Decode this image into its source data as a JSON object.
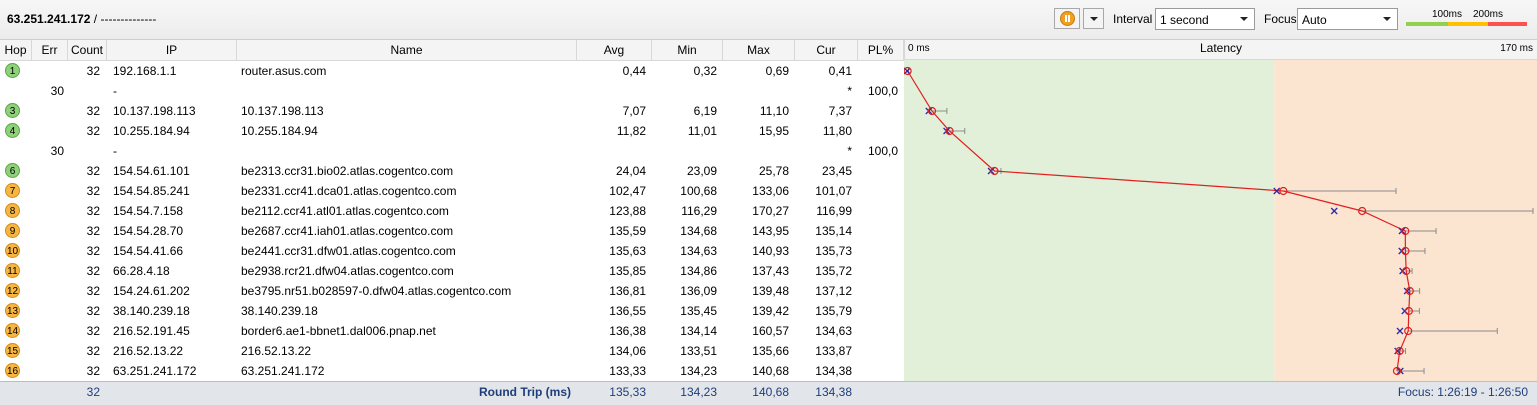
{
  "target": {
    "host": "63.251.241.172",
    "separator": "/",
    "name": "--------------"
  },
  "controls": {
    "interval_label": "Interval",
    "interval_value": "1 second",
    "focus_label": "Focus",
    "focus_value": "Auto",
    "legend": {
      "low": "100ms",
      "high": "200ms"
    }
  },
  "columns": {
    "hop": "Hop",
    "err": "Err",
    "count": "Count",
    "ip": "IP",
    "name": "Name",
    "avg": "Avg",
    "min": "Min",
    "max": "Max",
    "cur": "Cur",
    "pl": "PL%"
  },
  "rows": [
    {
      "hop": "1",
      "status": "green",
      "err": "",
      "count": "32",
      "ip": "192.168.1.1",
      "name": "router.asus.com",
      "avg": "0,44",
      "min": "0,32",
      "max": "0,69",
      "cur": "0,41",
      "pl": ""
    },
    {
      "hop": "",
      "status": "",
      "err": "30",
      "count": "",
      "ip": "-",
      "name": "",
      "avg": "",
      "min": "",
      "max": "",
      "cur": "*",
      "pl": "100,0"
    },
    {
      "hop": "3",
      "status": "green",
      "err": "",
      "count": "32",
      "ip": "10.137.198.113",
      "name": "10.137.198.113",
      "avg": "7,07",
      "min": "6,19",
      "max": "11,10",
      "cur": "7,37",
      "pl": ""
    },
    {
      "hop": "4",
      "status": "green",
      "err": "",
      "count": "32",
      "ip": "10.255.184.94",
      "name": "10.255.184.94",
      "avg": "11,82",
      "min": "11,01",
      "max": "15,95",
      "cur": "11,80",
      "pl": ""
    },
    {
      "hop": "",
      "status": "",
      "err": "30",
      "count": "",
      "ip": "-",
      "name": "",
      "avg": "",
      "min": "",
      "max": "",
      "cur": "*",
      "pl": "100,0"
    },
    {
      "hop": "6",
      "status": "green",
      "err": "",
      "count": "32",
      "ip": "154.54.61.101",
      "name": "be2313.ccr31.bio02.atlas.cogentco.com",
      "avg": "24,04",
      "min": "23,09",
      "max": "25,78",
      "cur": "23,45",
      "pl": ""
    },
    {
      "hop": "7",
      "status": "orange",
      "err": "",
      "count": "32",
      "ip": "154.54.85.241",
      "name": "be2331.ccr41.dca01.atlas.cogentco.com",
      "avg": "102,47",
      "min": "100,68",
      "max": "133,06",
      "cur": "101,07",
      "pl": ""
    },
    {
      "hop": "8",
      "status": "orange",
      "err": "",
      "count": "32",
      "ip": "154.54.7.158",
      "name": "be2112.ccr41.atl01.atlas.cogentco.com",
      "avg": "123,88",
      "min": "116,29",
      "max": "170,27",
      "cur": "116,99",
      "pl": ""
    },
    {
      "hop": "9",
      "status": "orange",
      "err": "",
      "count": "32",
      "ip": "154.54.28.70",
      "name": "be2687.ccr41.iah01.atlas.cogentco.com",
      "avg": "135,59",
      "min": "134,68",
      "max": "143,95",
      "cur": "135,14",
      "pl": ""
    },
    {
      "hop": "10",
      "status": "orange",
      "err": "",
      "count": "32",
      "ip": "154.54.41.66",
      "name": "be2441.ccr31.dfw01.atlas.cogentco.com",
      "avg": "135,63",
      "min": "134,63",
      "max": "140,93",
      "cur": "135,73",
      "pl": ""
    },
    {
      "hop": "11",
      "status": "orange",
      "err": "",
      "count": "32",
      "ip": "66.28.4.18",
      "name": "be2938.rcr21.dfw04.atlas.cogentco.com",
      "avg": "135,85",
      "min": "134,86",
      "max": "137,43",
      "cur": "135,72",
      "pl": ""
    },
    {
      "hop": "12",
      "status": "orange",
      "err": "",
      "count": "32",
      "ip": "154.24.61.202",
      "name": "be3795.nr51.b028597-0.dfw04.atlas.cogentco.com",
      "avg": "136,81",
      "min": "136,09",
      "max": "139,48",
      "cur": "137,12",
      "pl": ""
    },
    {
      "hop": "13",
      "status": "orange",
      "err": "",
      "count": "32",
      "ip": "38.140.239.18",
      "name": "38.140.239.18",
      "avg": "136,55",
      "min": "135,45",
      "max": "139,42",
      "cur": "135,79",
      "pl": ""
    },
    {
      "hop": "14",
      "status": "orange",
      "err": "",
      "count": "32",
      "ip": "216.52.191.45",
      "name": "border6.ae1-bbnet1.dal006.pnap.net",
      "avg": "136,38",
      "min": "134,14",
      "max": "160,57",
      "cur": "134,63",
      "pl": ""
    },
    {
      "hop": "15",
      "status": "orange",
      "err": "",
      "count": "32",
      "ip": "216.52.13.22",
      "name": "216.52.13.22",
      "avg": "134,06",
      "min": "133,51",
      "max": "135,66",
      "cur": "133,87",
      "pl": ""
    },
    {
      "hop": "16",
      "status": "orange",
      "err": "",
      "count": "32",
      "ip": "63.251.241.172",
      "name": "63.251.241.172",
      "avg": "133,33",
      "min": "134,23",
      "max": "140,68",
      "cur": "134,38",
      "pl": ""
    }
  ],
  "footer": {
    "count": "32",
    "label": "Round Trip (ms)",
    "avg": "135,33",
    "min": "134,23",
    "max": "140,68",
    "cur": "134,38",
    "focus_text": "Focus: 1:26:19 - 1:26:50"
  },
  "chart": {
    "title": "Latency",
    "min_label": "0 ms",
    "max_label": "170 ms",
    "max_ms": 170,
    "threshold_ms": 100
  },
  "colors": {
    "zone_low": "#e2f0d9",
    "zone_high": "#fbe5d0",
    "line": "#e0201f",
    "min_mark": "#2a2aa8",
    "whisker": "#8c8c8c",
    "legend_green": "#92d050",
    "legend_yellow": "#ffc000",
    "legend_red": "#ff5050"
  }
}
